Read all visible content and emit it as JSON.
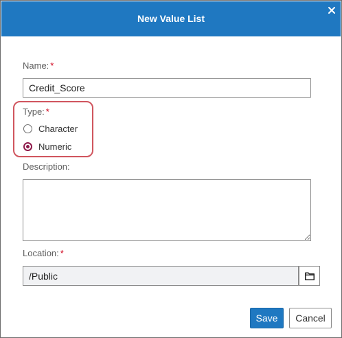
{
  "dialog": {
    "title": "New Value List",
    "close_icon": "close-icon"
  },
  "name": {
    "label": "Name:",
    "required_mark": "*",
    "value": "Credit_Score"
  },
  "type": {
    "label": "Type:",
    "required_mark": "*",
    "options": [
      {
        "label": "Character",
        "selected": false
      },
      {
        "label": "Numeric",
        "selected": true
      }
    ],
    "highlight_color": "#d0555e"
  },
  "description": {
    "label": "Description:",
    "value": ""
  },
  "location": {
    "label": "Location:",
    "required_mark": "*",
    "value": "/Public",
    "browse_icon": "folder-icon"
  },
  "buttons": {
    "save_label": "Save",
    "cancel_label": "Cancel"
  },
  "colors": {
    "titlebar": "#1f78c1",
    "primary_button": "#1f78c1",
    "required": "#d0021b",
    "radio_selected": "#8e1a4a"
  }
}
